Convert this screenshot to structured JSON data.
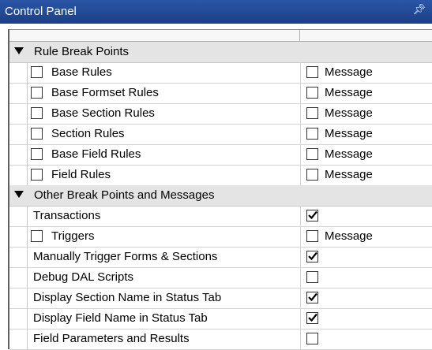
{
  "window": {
    "title": "Control Panel",
    "pin_icon": "pin-icon"
  },
  "categories": [
    {
      "label": "Rule Break Points"
    },
    {
      "label": "Other Break Points and Messages"
    }
  ],
  "rule_rows": [
    {
      "label": "Base Rules",
      "message": "Message"
    },
    {
      "label": "Base Formset Rules",
      "message": "Message"
    },
    {
      "label": "Base Section Rules",
      "message": "Message"
    },
    {
      "label": "Section Rules",
      "message": "Message"
    },
    {
      "label": "Base Field Rules",
      "message": "Message"
    },
    {
      "label": "Field Rules",
      "message": "Message"
    }
  ],
  "other_rows": [
    {
      "label": "Transactions",
      "checked": true
    },
    {
      "label": "Triggers",
      "message": "Message"
    },
    {
      "label": "Manually Trigger Forms & Sections",
      "checked": true
    },
    {
      "label": "Debug DAL Scripts",
      "checked": false
    },
    {
      "label": "Display Section Name in Status Tab",
      "checked": true
    },
    {
      "label": "Display Field Name in Status Tab",
      "checked": true
    },
    {
      "label": "Field Parameters and Results",
      "checked": false
    }
  ]
}
